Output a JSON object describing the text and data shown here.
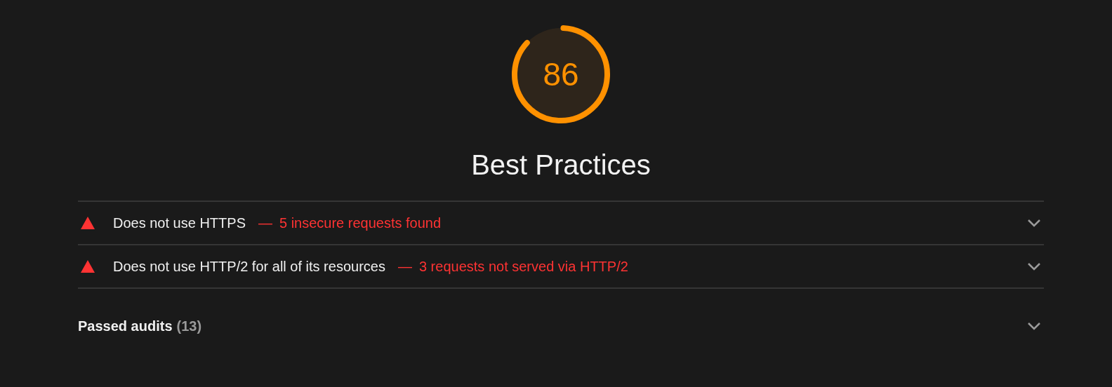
{
  "gauge": {
    "score": "86"
  },
  "category": {
    "title": "Best Practices"
  },
  "audits": [
    {
      "title": "Does not use HTTPS",
      "separator": "—",
      "detail": "5 insecure requests found",
      "expanded": false
    },
    {
      "title": "Does not use HTTP/2 for all of its resources",
      "separator": "—",
      "detail": "3 requests not served via HTTP/2",
      "expanded": false
    }
  ],
  "passed": {
    "label": "Passed audits",
    "count": "(13)",
    "expanded": false
  }
}
